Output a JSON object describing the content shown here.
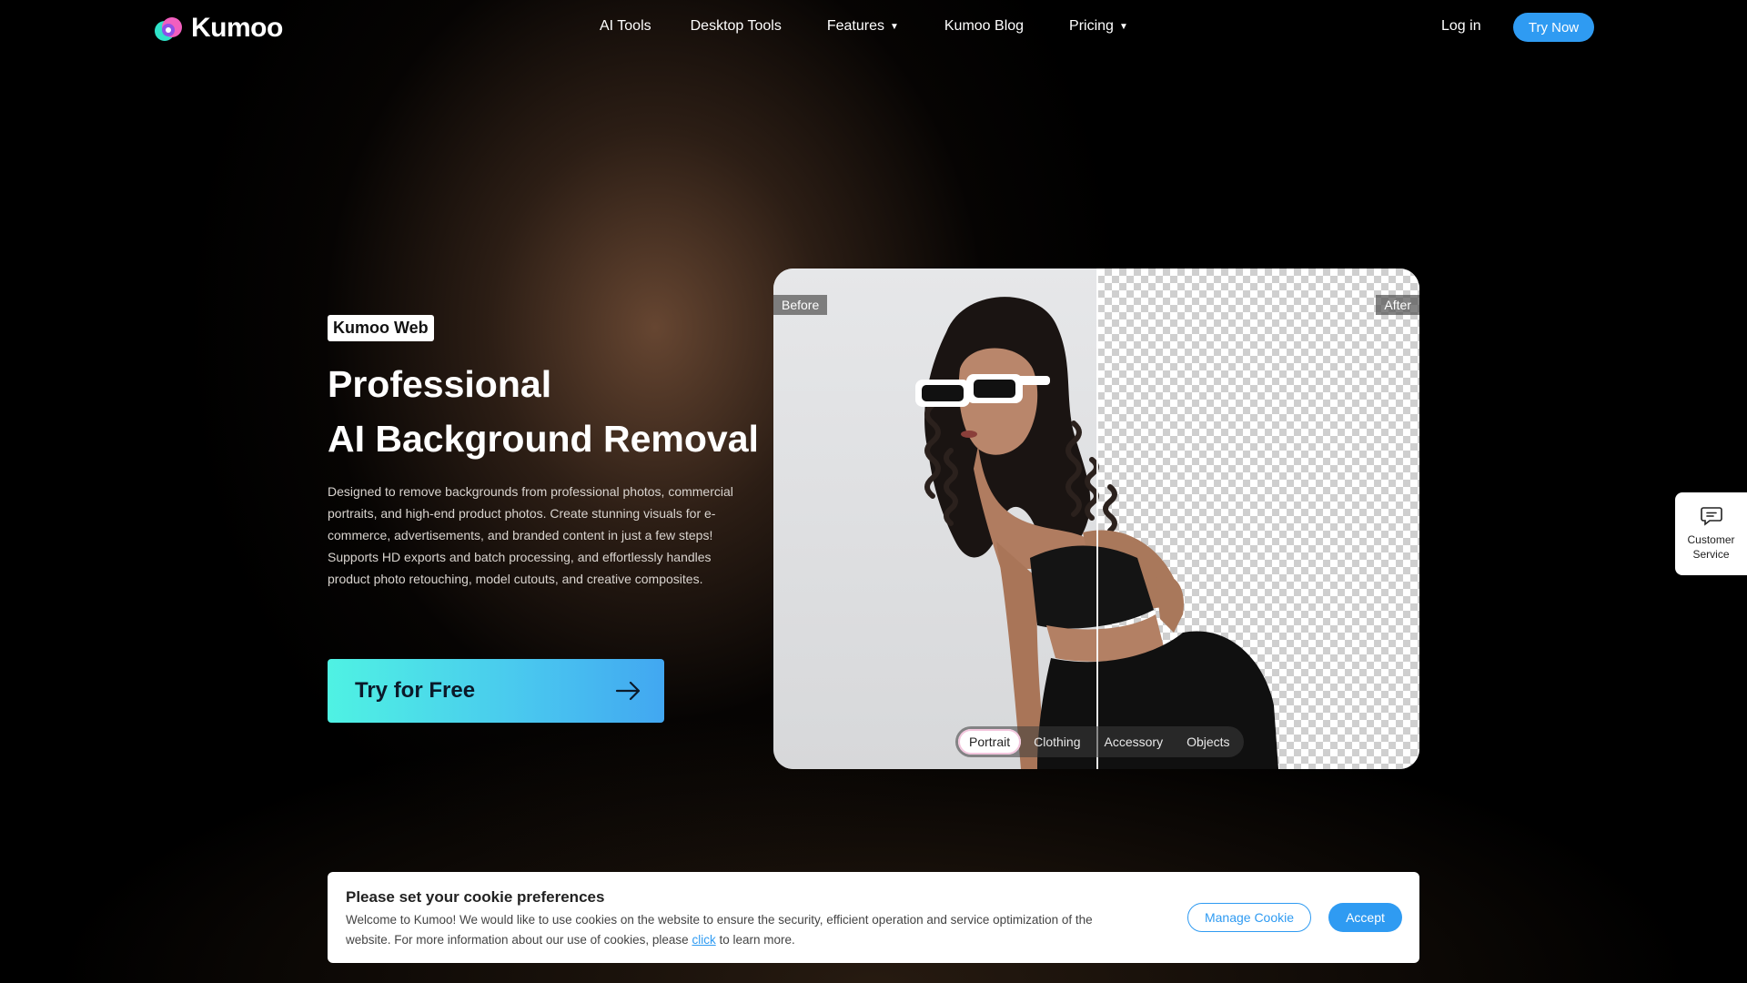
{
  "nav": {
    "brand": "Kumoo",
    "links": [
      {
        "label": "AI Tools"
      },
      {
        "label": "Desktop Tools"
      },
      {
        "label": "Features"
      },
      {
        "label": "Kumoo Blog"
      },
      {
        "label": "Pricing"
      }
    ],
    "login": "Log in",
    "try_now": "Try Now"
  },
  "hero": {
    "badge": "Kumoo Web",
    "title_line1": "Professional",
    "title_line2": "AI Background Removal",
    "desc1": "Designed to remove backgrounds from professional photos, commercial portraits, and high-end product photos. Create stunning visuals for e-commerce, advertisements, and branded content in just a few steps!",
    "desc2": "Supports HD exports and batch processing, and effortlessly handles product photo retouching, model cutouts, and creative composites.",
    "cta": "Try for Free"
  },
  "compare": {
    "before_label": "Before",
    "after_label": "After",
    "tabs": [
      "Portrait",
      "Clothing",
      "Accessory",
      "Objects"
    ],
    "active_tab": "Portrait"
  },
  "customer_service": {
    "line1": "Customer",
    "line2": "Service"
  },
  "cookie": {
    "title": "Please set your cookie preferences",
    "text_before": "Welcome to Kumoo! We would like to use cookies on the website to ensure the security, efficient operation and service optimization of the website. For more information about our use of cookies, please ",
    "link": "click",
    "text_after": " to learn more.",
    "manage": "Manage Cookie",
    "accept": "Accept"
  },
  "colors": {
    "accent": "#2f9bf2",
    "cta_start": "#4ff2e3",
    "cta_end": "#42a7f1"
  }
}
